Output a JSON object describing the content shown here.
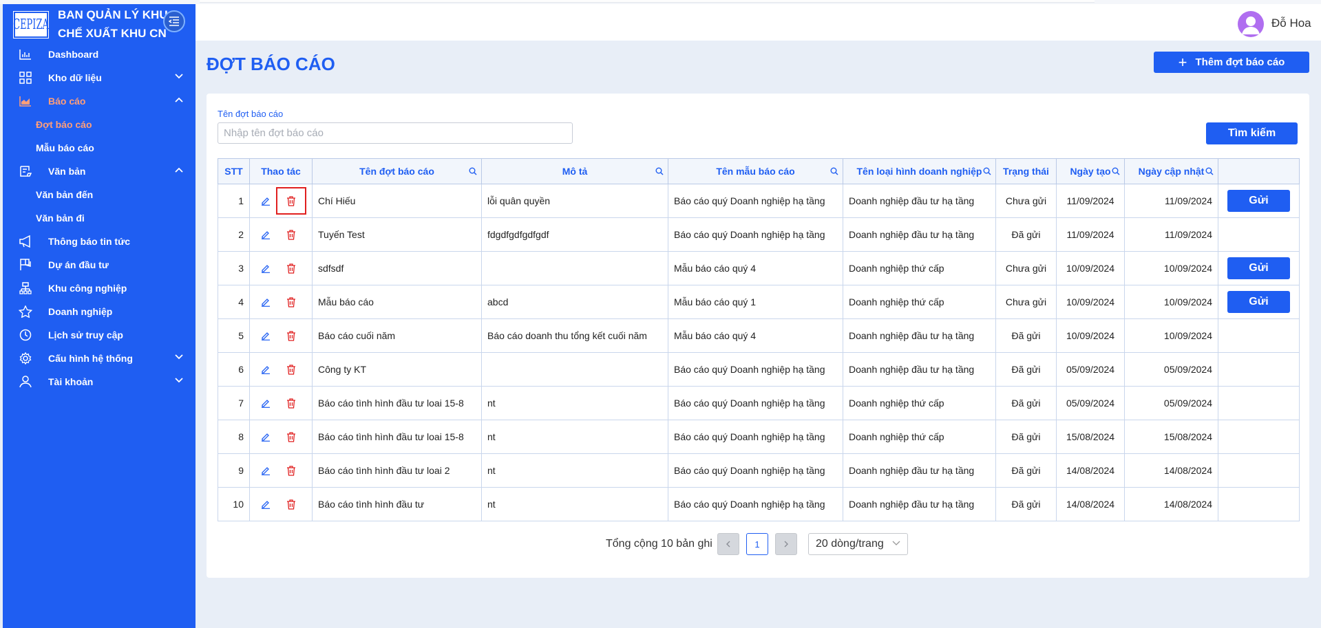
{
  "brand": {
    "logo_text": "CEPIZA",
    "title_line1": "BAN QUẢN LÝ KHU",
    "title_line2": "CHẾ XUẤT KHU CN"
  },
  "sidebar": {
    "items": [
      {
        "label": "Dashboard",
        "icon": "bar-chart-icon"
      },
      {
        "label": "Kho dữ liệu",
        "icon": "grid-icon",
        "chevron": "down"
      },
      {
        "label": "Báo cáo",
        "icon": "area-chart-icon",
        "chevron": "up",
        "active": true
      },
      {
        "label": "Văn bản",
        "icon": "document-icon",
        "chevron": "up"
      },
      {
        "label": "Thông báo tin tức",
        "icon": "megaphone-icon"
      },
      {
        "label": "Dự án đầu tư",
        "icon": "flag-icon"
      },
      {
        "label": "Khu công nghiệp",
        "icon": "sitemap-icon"
      },
      {
        "label": "Doanh nghiệp",
        "icon": "star-icon"
      },
      {
        "label": "Lịch sử truy cập",
        "icon": "clock-icon"
      },
      {
        "label": "Cấu hình hệ thống",
        "icon": "gear-icon",
        "chevron": "down"
      },
      {
        "label": "Tài khoản",
        "icon": "user-icon",
        "chevron": "down"
      }
    ],
    "bao_cao_sub": [
      "Đợt báo cáo",
      "Mẫu báo cáo"
    ],
    "van_ban_sub": [
      "Văn bản đến",
      "Văn bản đi"
    ]
  },
  "header": {
    "username": "Đỗ Hoa"
  },
  "page": {
    "title": "ĐỢT BÁO CÁO",
    "add_button": "Thêm đợt báo cáo"
  },
  "search": {
    "label": "Tên đợt báo cáo",
    "placeholder": "Nhập tên đợt báo cáo",
    "button": "Tìm kiếm"
  },
  "table": {
    "columns": [
      "STT",
      "Thao tác",
      "Tên đợt báo cáo",
      "Mô tả",
      "Tên mẫu báo cáo",
      "Tên loại hình doanh nghiệp",
      "Trạng thái",
      "Ngày tạo",
      "Ngày cập nhật",
      ""
    ],
    "send_label": "Gửi",
    "rows": [
      {
        "stt": "1",
        "name": "Chí Hiếu",
        "desc": "lỗi quân quyền",
        "template": "Báo cáo quý Doanh nghiệp hạ tầng",
        "type": "Doanh nghiệp đầu tư hạ tầng",
        "status": "Chưa gửi",
        "created": "11/09/2024",
        "updated": "11/09/2024",
        "can_send": true
      },
      {
        "stt": "2",
        "name": "Tuyến Test",
        "desc": "fdgdfgdfgdfgdf",
        "template": "Báo cáo quý Doanh nghiệp hạ tầng",
        "type": "Doanh nghiệp đầu tư hạ tầng",
        "status": "Đã gửi",
        "created": "11/09/2024",
        "updated": "11/09/2024",
        "can_send": false
      },
      {
        "stt": "3",
        "name": "sdfsdf",
        "desc": "",
        "template": "Mẫu báo cáo quý 4",
        "type": "Doanh nghiệp thứ cấp",
        "status": "Chưa gửi",
        "created": "10/09/2024",
        "updated": "10/09/2024",
        "can_send": true
      },
      {
        "stt": "4",
        "name": "Mẫu báo cáo",
        "desc": "abcd",
        "template": "Mẫu báo cáo quý 1",
        "type": "Doanh nghiệp thứ cấp",
        "status": "Chưa gửi",
        "created": "10/09/2024",
        "updated": "10/09/2024",
        "can_send": true
      },
      {
        "stt": "5",
        "name": "Báo cáo cuối năm",
        "desc": "Báo cáo doanh thu tổng kết cuối năm",
        "template": "Mẫu báo cáo quý 4",
        "type": "Doanh nghiệp đầu tư hạ tầng",
        "status": "Đã gửi",
        "created": "10/09/2024",
        "updated": "10/09/2024",
        "can_send": false
      },
      {
        "stt": "6",
        "name": "Công ty KT",
        "desc": "",
        "template": "Báo cáo quý Doanh nghiệp hạ tầng",
        "type": "Doanh nghiệp đầu tư hạ tầng",
        "status": "Đã gửi",
        "created": "05/09/2024",
        "updated": "05/09/2024",
        "can_send": false
      },
      {
        "stt": "7",
        "name": "Báo cáo tình hình đầu tư loai 15-8",
        "desc": "nt",
        "template": "Báo cáo quý Doanh nghiệp hạ tầng",
        "type": "Doanh nghiệp thứ cấp",
        "status": "Đã gửi",
        "created": "05/09/2024",
        "updated": "05/09/2024",
        "can_send": false
      },
      {
        "stt": "8",
        "name": "Báo cáo tình hình đầu tư loai 15-8",
        "desc": "nt",
        "template": "Báo cáo quý Doanh nghiệp hạ tầng",
        "type": "Doanh nghiệp thứ cấp",
        "status": "Đã gửi",
        "created": "15/08/2024",
        "updated": "15/08/2024",
        "can_send": false
      },
      {
        "stt": "9",
        "name": "Báo cáo tình hình đầu tư loai 2",
        "desc": "nt",
        "template": "Báo cáo quý Doanh nghiệp hạ tầng",
        "type": "Doanh nghiệp đầu tư hạ tầng",
        "status": "Đã gửi",
        "created": "14/08/2024",
        "updated": "14/08/2024",
        "can_send": false
      },
      {
        "stt": "10",
        "name": "Báo cáo tình hình đầu tư",
        "desc": "nt",
        "template": "Báo cáo quý Doanh nghiệp hạ tầng",
        "type": "Doanh nghiệp đầu tư hạ tầng",
        "status": "Đã gửi",
        "created": "14/08/2024",
        "updated": "14/08/2024",
        "can_send": false
      }
    ]
  },
  "pagination": {
    "total_text": "Tổng cộng 10 bản ghi",
    "current_page": "1",
    "page_size": "20 dòng/trang"
  },
  "colors": {
    "primary": "#1f5ef2",
    "active_nav": "#ff9e7a",
    "status_pending": "#19a73a",
    "status_sent": "#f08c1e",
    "delete": "#e01f1f"
  }
}
